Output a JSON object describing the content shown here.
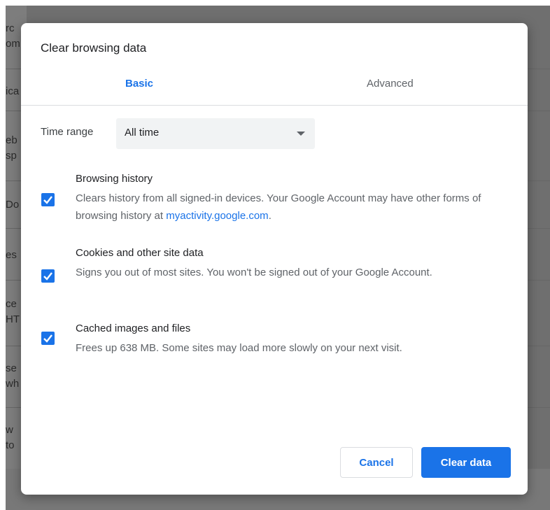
{
  "background": {
    "snippets": [
      "rc",
      "om",
      "ica",
      "eb",
      "sp",
      "Do",
      "es",
      "ce",
      "HT",
      "se",
      "wh",
      "w",
      "to"
    ]
  },
  "dialog": {
    "title": "Clear browsing data",
    "tabs": [
      {
        "label": "Basic",
        "active": true
      },
      {
        "label": "Advanced",
        "active": false
      }
    ],
    "time_range": {
      "label": "Time range",
      "value": "All time"
    },
    "options": [
      {
        "title": "Browsing history",
        "description_prefix": "Clears history from all signed-in devices. Your Google Account may have other forms of browsing history at ",
        "link": "myactivity.google.com",
        "description_suffix": ".",
        "checked": true
      },
      {
        "title": "Cookies and other site data",
        "description": "Signs you out of most sites. You won't be signed out of your Google Account.",
        "checked": true
      },
      {
        "title": "Cached images and files",
        "description": "Frees up 638 MB. Some sites may load more slowly on your next visit.",
        "checked": true
      }
    ],
    "buttons": {
      "cancel": "Cancel",
      "clear": "Clear data"
    }
  },
  "colors": {
    "accent": "#1a73e8",
    "backdrop": "#6f6f6f"
  }
}
